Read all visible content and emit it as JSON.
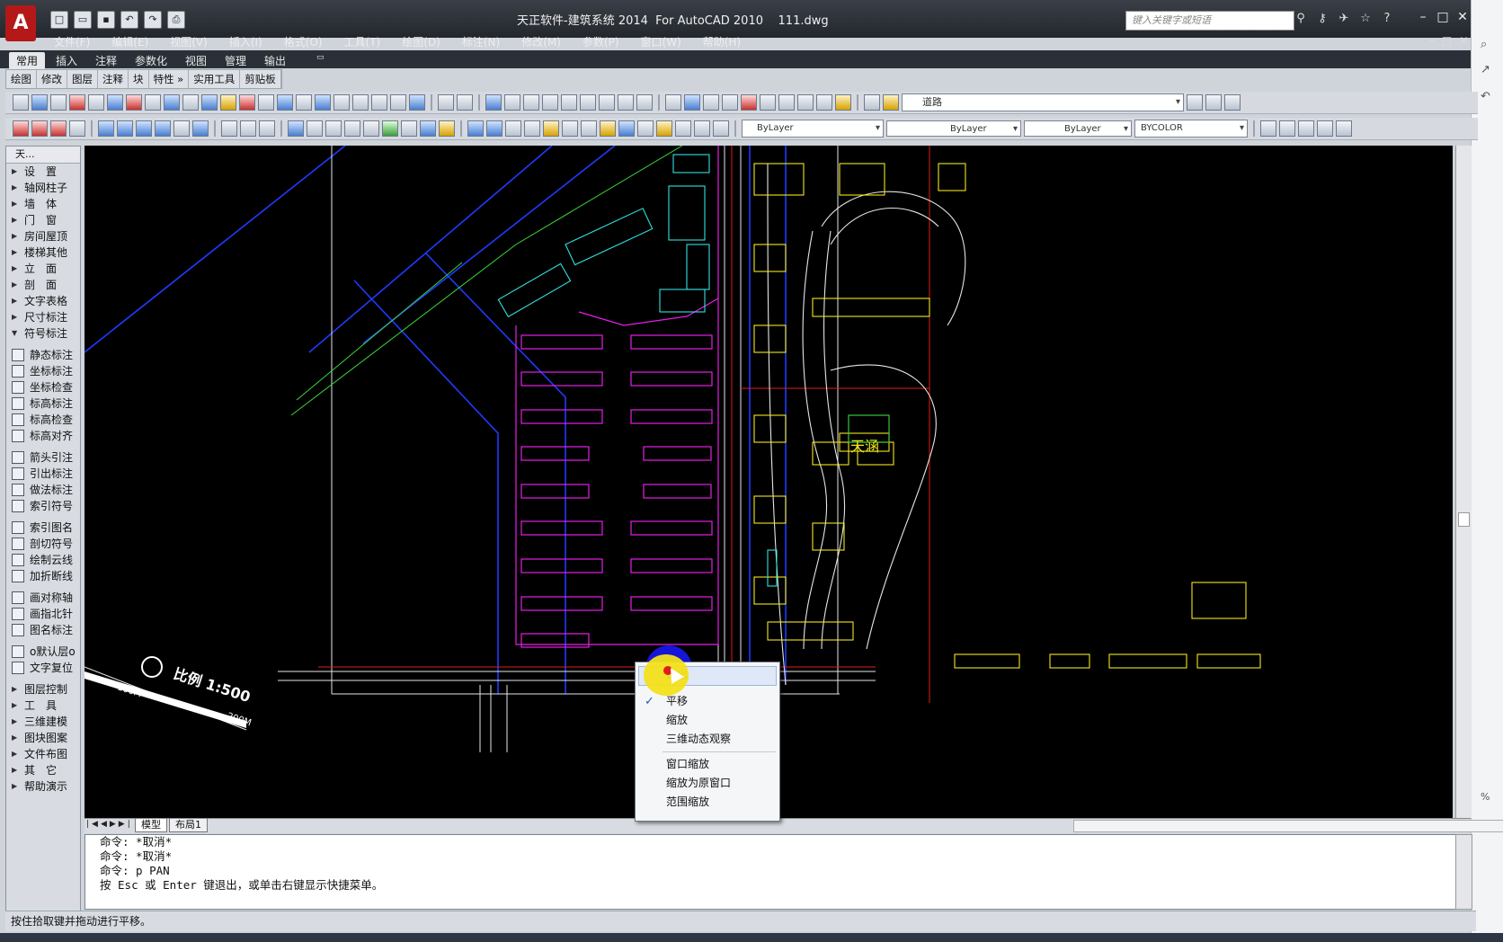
{
  "title": "天正软件-建筑系统 2014  For AutoCAD 2010    111.dwg",
  "search_placeholder": "键入关键字或短语",
  "menu": [
    "文件(F)",
    "编辑(E)",
    "视图(V)",
    "插入(I)",
    "格式(O)",
    "工具(T)",
    "绘图(D)",
    "标注(N)",
    "修改(M)",
    "参数(P)",
    "窗口(W)",
    "帮助(H)"
  ],
  "ribbon_tabs": [
    "常用",
    "插入",
    "注释",
    "参数化",
    "视图",
    "管理",
    "输出"
  ],
  "ribbon_panels": [
    "绘图",
    "修改",
    "图层",
    "注释",
    "块",
    "特性 »",
    "实用工具",
    "剪贴板"
  ],
  "layer_combo": "道路",
  "props": {
    "color": "ByLayer",
    "linetype": "ByLayer",
    "lineweight": "ByLayer",
    "plot": "BYCOLOR"
  },
  "sidebar": {
    "title": "天...",
    "groups": [
      [
        {
          "label": "设　置",
          "arrow": true
        },
        {
          "label": "轴网柱子",
          "arrow": true
        },
        {
          "label": "墙　体",
          "arrow": true
        },
        {
          "label": "门　窗",
          "arrow": true
        },
        {
          "label": "房间屋顶",
          "arrow": true
        },
        {
          "label": "楼梯其他",
          "arrow": true
        },
        {
          "label": "立　面",
          "arrow": true
        },
        {
          "label": "剖　面",
          "arrow": true
        },
        {
          "label": "文字表格",
          "arrow": true
        },
        {
          "label": "尺寸标注",
          "arrow": true
        },
        {
          "label": "符号标注",
          "arrow": "open"
        }
      ],
      [
        {
          "label": "静态标注"
        },
        {
          "label": "坐标标注"
        },
        {
          "label": "坐标检查"
        },
        {
          "label": "标高标注"
        },
        {
          "label": "标高检查"
        },
        {
          "label": "标高对齐"
        }
      ],
      [
        {
          "label": "箭头引注"
        },
        {
          "label": "引出标注"
        },
        {
          "label": "做法标注"
        },
        {
          "label": "索引符号"
        }
      ],
      [
        {
          "label": "索引图名"
        },
        {
          "label": "剖切符号"
        },
        {
          "label": "绘制云线"
        },
        {
          "label": "加折断线"
        }
      ],
      [
        {
          "label": "画对称轴"
        },
        {
          "label": "画指北针"
        },
        {
          "label": "图名标注"
        }
      ],
      [
        {
          "label": "o默认层o"
        },
        {
          "label": "文字复位"
        }
      ],
      [
        {
          "label": "图层控制",
          "arrow": true
        },
        {
          "label": "工　具",
          "arrow": true
        },
        {
          "label": "三维建模",
          "arrow": true
        },
        {
          "label": "图块图案",
          "arrow": true
        },
        {
          "label": "文件布图",
          "arrow": true
        },
        {
          "label": "其　它",
          "arrow": true
        },
        {
          "label": "帮助演示",
          "arrow": true
        }
      ]
    ]
  },
  "drawing": {
    "scale_label": "比例 1:500",
    "scale_100": "100M",
    "scale_200": "200M",
    "watermark": "天涵"
  },
  "tabs": [
    "模型",
    "布局1"
  ],
  "context_menu": [
    "退出",
    "平移",
    "缩放",
    "三维动态观察",
    "窗口缩放",
    "缩放为原窗口",
    "范围缩放"
  ],
  "command_lines": [
    "命令: *取消*",
    "命令: *取消*",
    "命令: p PAN",
    "按 Esc 或 Enter 键退出，或单击右键显示快捷菜单。"
  ],
  "status_text": "按住拾取键并拖动进行平移。"
}
